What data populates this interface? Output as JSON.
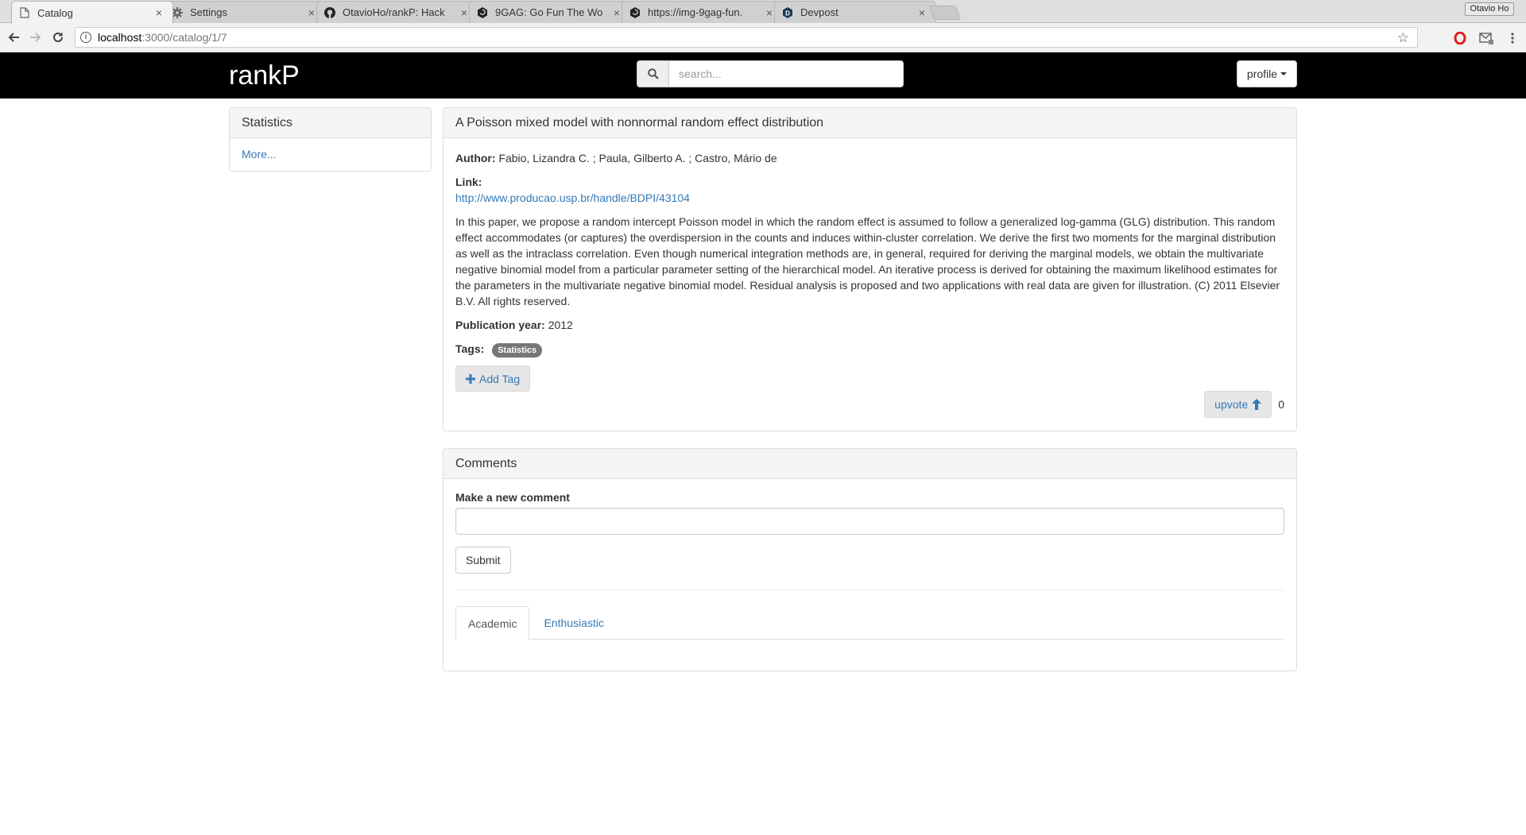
{
  "browser": {
    "tabs": [
      {
        "label": "Catalog",
        "icon": "page-icon",
        "active": true
      },
      {
        "label": "Settings",
        "icon": "gear-icon",
        "active": false
      },
      {
        "label": "OtavioHo/rankP: Hack",
        "icon": "github-icon",
        "active": false
      },
      {
        "label": "9GAG: Go Fun The Wo",
        "icon": "9gag-icon",
        "active": false
      },
      {
        "label": "https://img-9gag-fun.",
        "icon": "9gag-icon",
        "active": false
      },
      {
        "label": "Devpost",
        "icon": "devpost-icon",
        "active": false
      }
    ],
    "close_glyph": "×",
    "profile_name": "Otavio Ho",
    "url_host": "localhost",
    "url_path": ":3000/catalog/1/7"
  },
  "navbar": {
    "brand": "rankP",
    "search_placeholder": "search...",
    "profile_label": "profile"
  },
  "sidebar": {
    "title": "Statistics",
    "more_link": "More..."
  },
  "paper": {
    "title": "A Poisson mixed model with nonnormal random effect distribution",
    "author_label": "Author:",
    "author_value": "Fabio, Lizandra C. ; Paula, Gilberto A. ; Castro, Mário de",
    "link_label": "Link:",
    "link_url": "http://www.producao.usp.br/handle/BDPI/43104",
    "abstract": "In this paper, we propose a random intercept Poisson model in which the random effect is assumed to follow a generalized log-gamma (GLG) distribution. This random effect accommodates (or captures) the overdispersion in the counts and induces within-cluster correlation. We derive the first two moments for the marginal distribution as well as the intraclass correlation. Even though numerical integration methods are, in general, required for deriving the marginal models, we obtain the multivariate negative binomial model from a particular parameter setting of the hierarchical model. An iterative process is derived for obtaining the maximum likelihood estimates for the parameters in the multivariate negative binomial model. Residual analysis is proposed and two applications with real data are given for illustration. (C) 2011 Elsevier B.V. All rights reserved.",
    "year_label": "Publication year:",
    "year_value": "2012",
    "tags_label": "Tags:",
    "tags": [
      "Statistics"
    ],
    "add_tag_label": "Add Tag",
    "upvote_label": "upvote",
    "vote_count": "0"
  },
  "comments": {
    "title": "Comments",
    "new_comment_label": "Make a new comment",
    "comment_value": "",
    "submit_label": "Submit",
    "tabs": [
      {
        "label": "Academic",
        "active": true
      },
      {
        "label": "Enthusiastic",
        "active": false
      }
    ]
  },
  "colors": {
    "navbar_bg": "#000000",
    "link": "#337ab7",
    "tag_bg": "#777777"
  }
}
